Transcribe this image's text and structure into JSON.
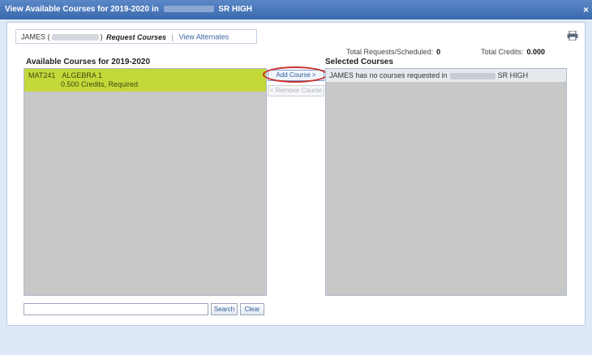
{
  "window": {
    "title_prefix": "View Available Courses for 2019-2020 in",
    "title_suffix": "SR HIGH",
    "close_glyph": "×"
  },
  "tabs": {
    "student_name": "JAMES (",
    "student_close": ")",
    "active": "Request Courses",
    "separator": "|",
    "alternates": "View Alternates"
  },
  "totals": {
    "requests_label": "Total Requests/Scheduled:",
    "requests_value": "0",
    "credits_label": "Total Credits:",
    "credits_value": "0.000"
  },
  "available": {
    "header": "Available Courses for 2019-2020",
    "courses": [
      {
        "code": "MAT241",
        "name": "ALGEBRA 1",
        "details": "0.500 Credits,  Required"
      }
    ]
  },
  "actions": {
    "add_label": "Add Course >",
    "remove_label": "< Remove Course"
  },
  "selected": {
    "header": "Selected Courses",
    "message_prefix": "JAMES has no courses requested in",
    "message_suffix": "SR HIGH"
  },
  "search": {
    "placeholder": "",
    "search_label": "Search",
    "clear_label": "Clear"
  },
  "icons": {
    "print": "printer-icon"
  }
}
